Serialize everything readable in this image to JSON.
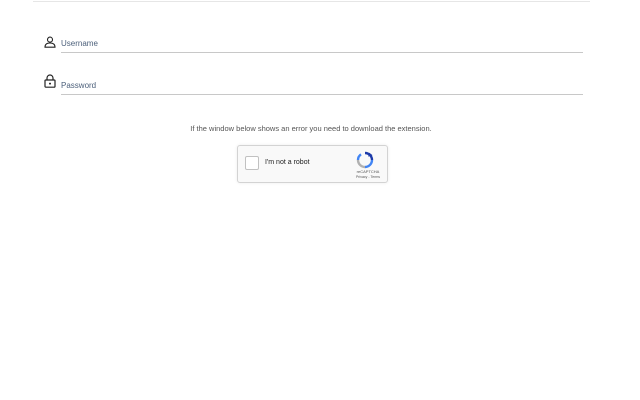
{
  "login_form": {
    "username": {
      "placeholder": "Username",
      "value": "",
      "icon": "user-icon"
    },
    "password": {
      "placeholder": "Password",
      "value": "",
      "icon": "lock-icon"
    }
  },
  "notice_text": "If the window below shows an error you need to download the extension.",
  "captcha": {
    "label": "I'm not a robot",
    "brand": "reCAPTCHA",
    "privacy_link": "Privacy",
    "separator": " - ",
    "terms_link": "Terms",
    "checked": false,
    "icon": "recaptcha-logo-icon",
    "colors": {
      "blue": "#1c3aa9",
      "light_blue": "#4285f4",
      "gray": "#b1b1b1"
    }
  }
}
